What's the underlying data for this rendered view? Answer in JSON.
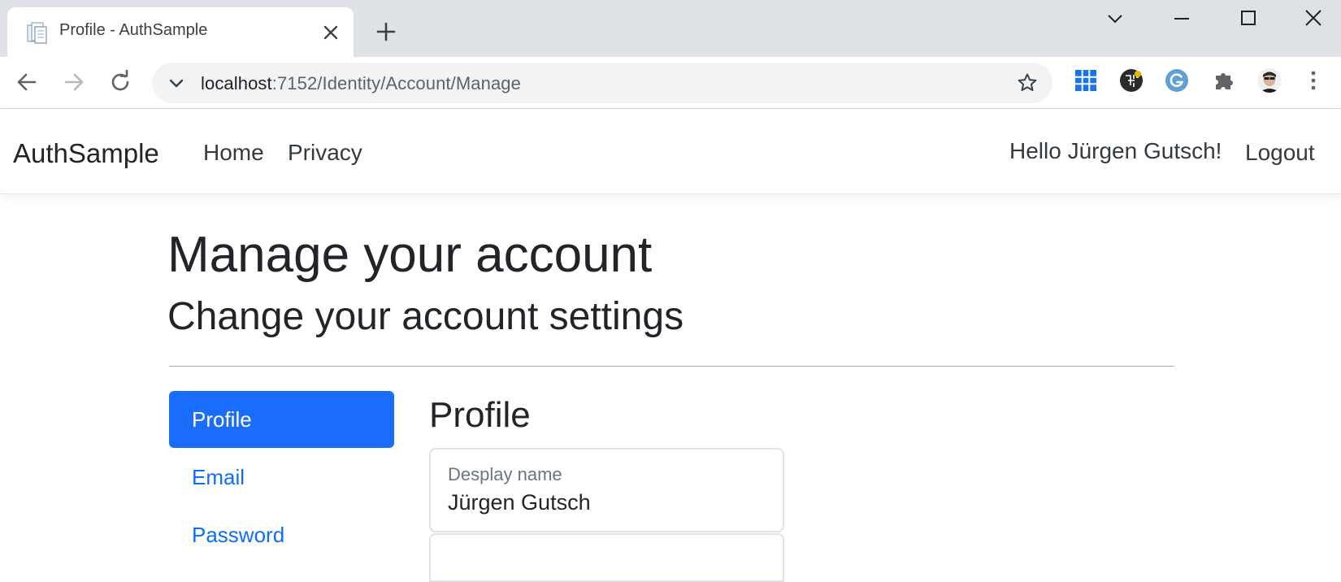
{
  "browser": {
    "tab_title": "Profile - AuthSample",
    "address": {
      "host": "localhost",
      "path": ":7152/Identity/Account/Manage"
    }
  },
  "site": {
    "brand": "AuthSample",
    "nav": {
      "home": "Home",
      "privacy": "Privacy"
    },
    "greeting": "Hello Jürgen Gutsch!",
    "logout": "Logout"
  },
  "page": {
    "title": "Manage your account",
    "subtitle": "Change your account settings",
    "sidebar": [
      {
        "label": "Profile",
        "active": true
      },
      {
        "label": "Email",
        "active": false
      },
      {
        "label": "Password",
        "active": false
      }
    ],
    "section_title": "Profile",
    "display_name": {
      "label": "Desplay name",
      "value": "Jürgen Gutsch"
    }
  },
  "colors": {
    "accent": "#1a6dfc",
    "link": "#0d6efd",
    "text": "#212529"
  }
}
